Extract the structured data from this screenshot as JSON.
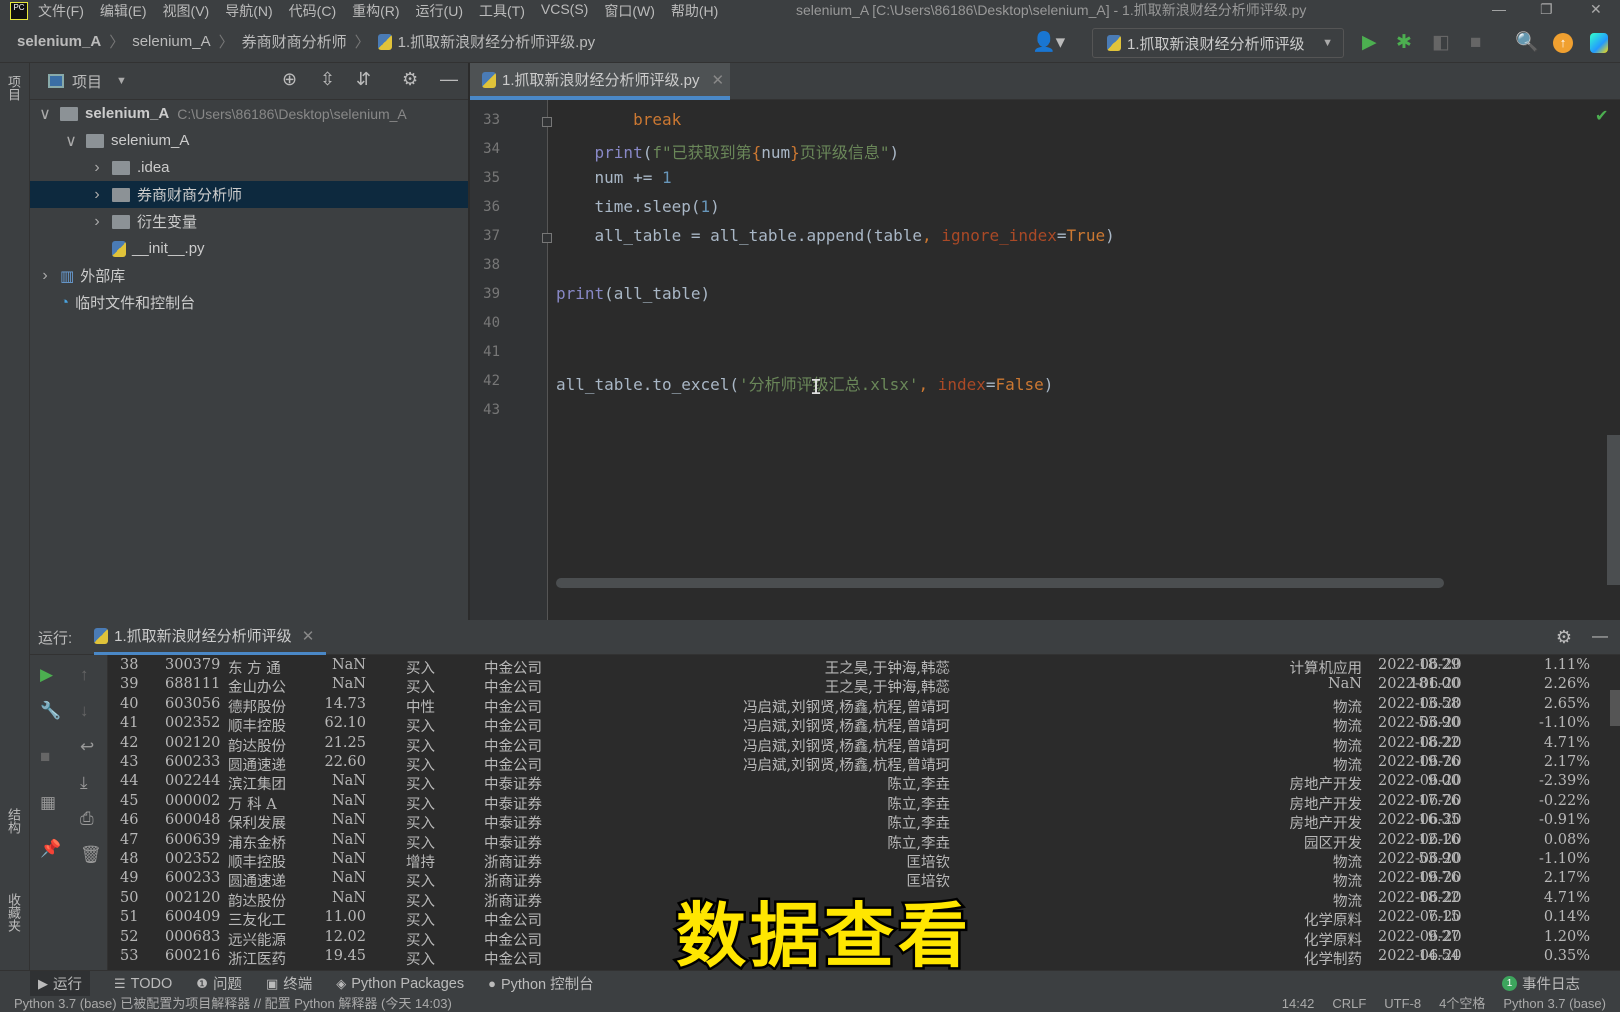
{
  "menubar": {
    "items": [
      "文件(F)",
      "编辑(E)",
      "视图(V)",
      "导航(N)",
      "代码(C)",
      "重构(R)",
      "运行(U)",
      "工具(T)",
      "VCS(S)",
      "窗口(W)",
      "帮助(H)"
    ],
    "window_title": "selenium_A [C:\\Users\\86186\\Desktop\\selenium_A] - 1.抓取新浪财经分析师评级.py"
  },
  "breadcrumb": [
    "selenium_A",
    "selenium_A",
    "券商财商分析师",
    "1.抓取新浪财经分析师评级.py"
  ],
  "toolbar": {
    "run_config": "1.抓取新浪财经分析师评级"
  },
  "left_strip": {
    "project": "项目",
    "structure": "结构",
    "favorites": "收藏夹"
  },
  "project": {
    "title": "项目",
    "tree": [
      {
        "label": "selenium_A",
        "path": "C:\\Users\\86186\\Desktop\\selenium_A",
        "arrow": "v",
        "type": "folder",
        "bold": true
      },
      {
        "label": "selenium_A",
        "arrow": "v",
        "type": "folder"
      },
      {
        "label": ".idea",
        "arrow": ">",
        "type": "folder"
      },
      {
        "label": "券商财商分析师",
        "arrow": ">",
        "type": "folder",
        "selected": true
      },
      {
        "label": "衍生变量",
        "arrow": ">",
        "type": "folder"
      },
      {
        "label": "__init__.py",
        "arrow": "",
        "type": "python"
      },
      {
        "label": "外部库",
        "arrow": ">",
        "type": "library"
      },
      {
        "label": "临时文件和控制台",
        "arrow": "",
        "type": "scratch"
      }
    ]
  },
  "editor": {
    "tab": "1.抓取新浪财经分析师评级.py",
    "lines": [
      {
        "n": "33",
        "indent": "        ",
        "tokens": [
          {
            "t": "break",
            "c": "kw"
          }
        ],
        "fold": true
      },
      {
        "n": "34",
        "indent": "    ",
        "tokens": [
          {
            "t": "print",
            "c": "bi"
          },
          {
            "t": "(",
            "c": ""
          },
          {
            "t": "f\"已获取到第",
            "c": "st"
          },
          {
            "t": "{",
            "c": "fb"
          },
          {
            "t": "num",
            "c": ""
          },
          {
            "t": "}",
            "c": "fb"
          },
          {
            "t": "页评级信息\"",
            "c": "st"
          },
          {
            "t": ")",
            "c": ""
          }
        ]
      },
      {
        "n": "35",
        "indent": "    ",
        "tokens": [
          {
            "t": "num += ",
            "c": ""
          },
          {
            "t": "1",
            "c": "nu"
          }
        ]
      },
      {
        "n": "36",
        "indent": "    ",
        "tokens": [
          {
            "t": "time.sleep(",
            "c": ""
          },
          {
            "t": "1",
            "c": "nu"
          },
          {
            "t": ")",
            "c": ""
          }
        ]
      },
      {
        "n": "37",
        "indent": "    ",
        "tokens": [
          {
            "t": "all_table = all_table.append(table",
            "c": ""
          },
          {
            "t": ", ",
            "c": "kw"
          },
          {
            "t": "ignore_index",
            "c": "ka"
          },
          {
            "t": "=",
            "c": ""
          },
          {
            "t": "True",
            "c": "kw"
          },
          {
            "t": ")",
            "c": ""
          }
        ],
        "fold": true
      },
      {
        "n": "38",
        "indent": "",
        "tokens": []
      },
      {
        "n": "39",
        "indent": "",
        "tokens": [
          {
            "t": "print",
            "c": "bi"
          },
          {
            "t": "(all_table)",
            "c": ""
          }
        ]
      },
      {
        "n": "40",
        "indent": "",
        "tokens": []
      },
      {
        "n": "41",
        "indent": "",
        "tokens": []
      },
      {
        "n": "42",
        "indent": "",
        "tokens": [
          {
            "t": "all_table.to_excel(",
            "c": ""
          },
          {
            "t": "'分析师评级汇总.xlsx'",
            "c": "st"
          },
          {
            "t": ", ",
            "c": "kw"
          },
          {
            "t": "index",
            "c": "ka"
          },
          {
            "t": "=",
            "c": ""
          },
          {
            "t": "False",
            "c": "kw"
          },
          {
            "t": ")",
            "c": ""
          }
        ]
      },
      {
        "n": "43",
        "indent": "",
        "tokens": []
      }
    ]
  },
  "run": {
    "label": "运行:",
    "tab": "1.抓取新浪财经分析师评级",
    "rows": [
      [
        "38",
        "300379",
        "东 方 通",
        "NaN",
        "买入",
        "中金公司",
        "王之昊,于钟海,韩蕊",
        "计算机应用",
        "2022-06-20",
        "18.29",
        "1.11%"
      ],
      [
        "39",
        "688111",
        "金山办公",
        "NaN",
        "买入",
        "中金公司",
        "王之昊,于钟海,韩蕊",
        "NaN",
        "2022-06-20",
        "181.00",
        "2.26%"
      ],
      [
        "40",
        "603056",
        "德邦股份",
        "14.73",
        "中性",
        "中金公司",
        "冯启斌,刘钢贤,杨鑫,杭程,曾靖珂",
        "物流",
        "2022-06-20",
        "13.58",
        "2.65%"
      ],
      [
        "41",
        "002352",
        "顺丰控股",
        "62.10",
        "买入",
        "中金公司",
        "冯启斌,刘钢贤,杨鑫,杭程,曾靖珂",
        "物流",
        "2022-06-20",
        "53.90",
        "-1.10%"
      ],
      [
        "42",
        "002120",
        "韵达股份",
        "21.25",
        "买入",
        "中金公司",
        "冯启斌,刘钢贤,杨鑫,杭程,曾靖珂",
        "物流",
        "2022-06-20",
        "18.22",
        "4.71%"
      ],
      [
        "43",
        "600233",
        "圆通速递",
        "22.60",
        "买入",
        "中金公司",
        "冯启斌,刘钢贤,杨鑫,杭程,曾靖珂",
        "物流",
        "2022-06-20",
        "19.76",
        "2.17%"
      ],
      [
        "44",
        "002244",
        "滨江集团",
        "NaN",
        "买入",
        "中泰证券",
        "陈立,李垚",
        "房地产开发",
        "2022-06-20",
        "9.00",
        "-2.39%"
      ],
      [
        "45",
        "000002",
        "万 科 A",
        "NaN",
        "买入",
        "中泰证券",
        "陈立,李垚",
        "房地产开发",
        "2022-06-20",
        "17.76",
        "-0.22%"
      ],
      [
        "46",
        "600048",
        "保利发展",
        "NaN",
        "买入",
        "中泰证券",
        "陈立,李垚",
        "房地产开发",
        "2022-06-20",
        "16.35",
        "-0.91%"
      ],
      [
        "47",
        "600639",
        "浦东金桥",
        "NaN",
        "买入",
        "中泰证券",
        "陈立,李垚",
        "园区开发",
        "2022-06-20",
        "12.16",
        "0.08%"
      ],
      [
        "48",
        "002352",
        "顺丰控股",
        "NaN",
        "增持",
        "浙商证券",
        "匡培钦",
        "物流",
        "2022-06-20",
        "53.90",
        "-1.10%"
      ],
      [
        "49",
        "600233",
        "圆通速递",
        "NaN",
        "买入",
        "浙商证券",
        "匡培钦",
        "物流",
        "2022-06-20",
        "19.76",
        "2.17%"
      ],
      [
        "50",
        "002120",
        "韵达股份",
        "NaN",
        "买入",
        "浙商证券",
        "",
        "物流",
        "2022-06-20",
        "18.22",
        "4.71%"
      ],
      [
        "51",
        "600409",
        "三友化工",
        "11.00",
        "买入",
        "中金公司",
        "",
        "化学原料",
        "2022-06-20",
        "7.15",
        "0.14%"
      ],
      [
        "52",
        "000683",
        "远兴能源",
        "12.02",
        "买入",
        "中金公司",
        "",
        "化学原料",
        "2022-06-20",
        "9.27",
        "1.20%"
      ],
      [
        "53",
        "600216",
        "浙江医药",
        "19.45",
        "买入",
        "中金公司",
        "",
        "化学制药",
        "2022-06-20",
        "14.54",
        "0.35%"
      ]
    ]
  },
  "bottom_tabs": [
    {
      "label": "运行",
      "icon": "▶"
    },
    {
      "label": "TODO",
      "icon": "☰"
    },
    {
      "label": "问题",
      "icon": "❶"
    },
    {
      "label": "终端",
      "icon": "▣"
    },
    {
      "label": "Python Packages",
      "icon": "◈"
    },
    {
      "label": "Python 控制台",
      "icon": "●"
    }
  ],
  "event_log": {
    "count": "1",
    "label": "事件日志"
  },
  "statusbar": {
    "message": "Python 3.7 (base) 已被配置为项目解释器 // 配置 Python 解释器 (今天 14:03)",
    "items": [
      "14:42",
      "CRLF",
      "UTF-8",
      "4个空格",
      "Python 3.7 (base)"
    ]
  },
  "caption": "数据查看"
}
